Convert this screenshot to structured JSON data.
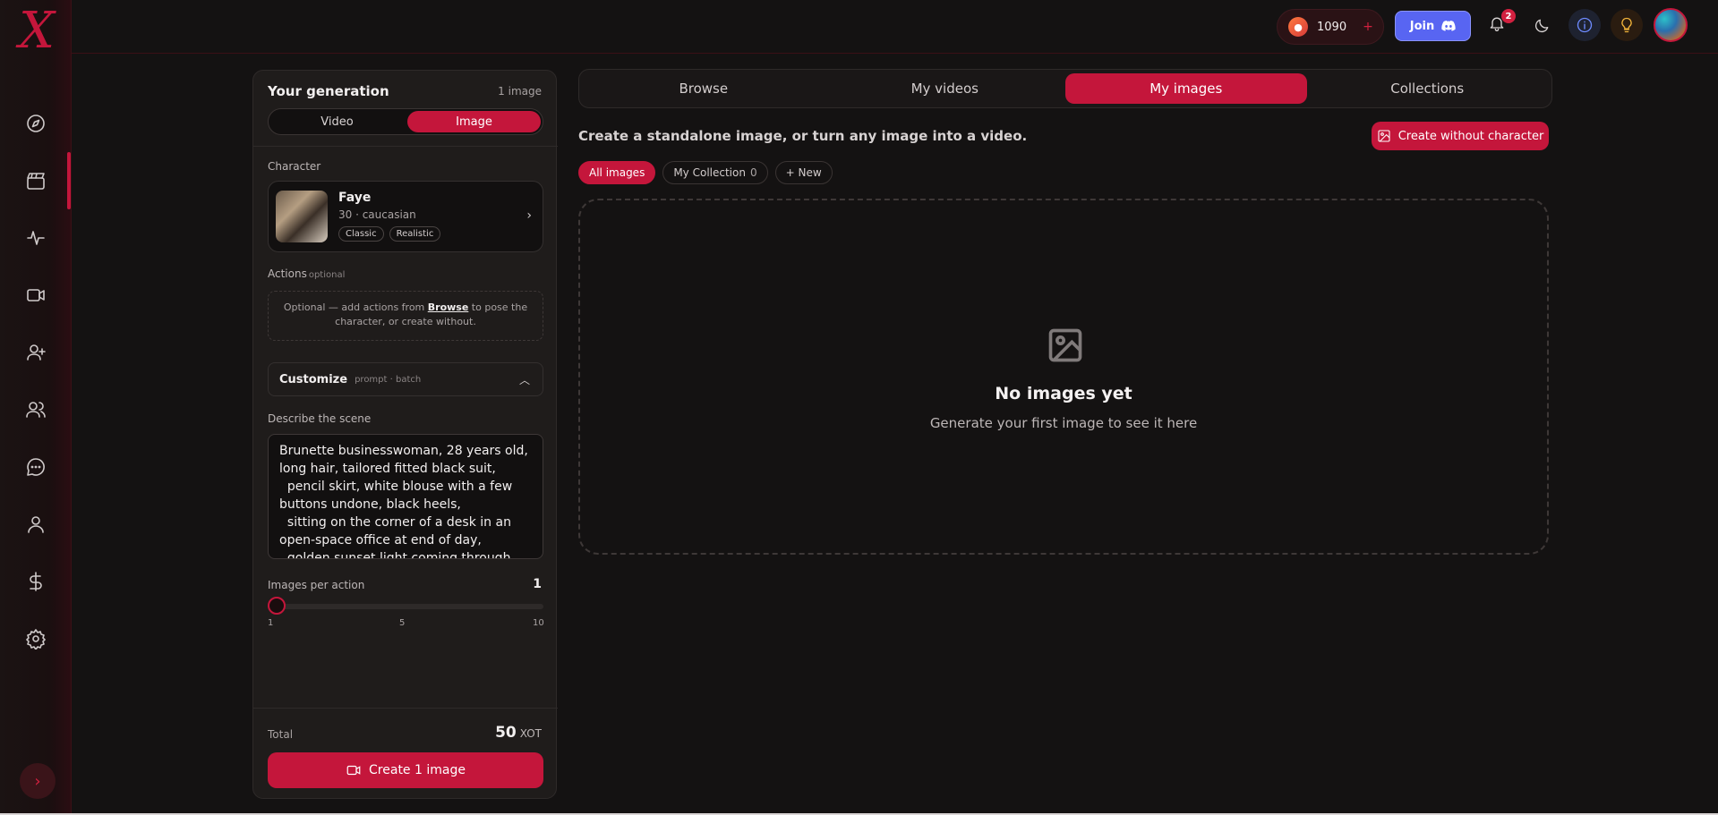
{
  "topbar": {
    "credits": "1090",
    "credits_plus": "+",
    "join_label": "Join",
    "notification_count": "2"
  },
  "sidebar": {
    "logo": "X",
    "items": [
      "explore",
      "clapperboard",
      "activity",
      "video",
      "user-plus",
      "users",
      "chat",
      "user",
      "dollar",
      "settings"
    ],
    "expand_glyph": "›"
  },
  "generation": {
    "title": "Your generation",
    "count": "1 image",
    "modes": [
      "Video",
      "Image"
    ],
    "active_mode": "Image",
    "character_label": "Character",
    "character": {
      "name": "Faye",
      "meta": "30 · caucasian",
      "tags": [
        "Classic",
        "Realistic"
      ]
    },
    "actions_label": "Actions",
    "actions_optional": "optional",
    "actions_hint_before": "Optional — add actions from ",
    "actions_hint_link": "Browse",
    "actions_hint_after": " to pose the character, or create without.",
    "customize_title": "Customize",
    "customize_sub": "prompt · batch",
    "scene_label": "Describe the scene",
    "scene_text": "Brunette businesswoman, 28 years old, long hair, tailored fitted black suit,\n  pencil skirt, white blouse with a few buttons undone, black heels,\n  sitting on the corner of a desk in an open-space office at end of day,\n  golden sunset light coming through",
    "images_per_action_label": "Images per action",
    "images_per_action_value": "1",
    "slider_min": "1",
    "slider_mid": "5",
    "slider_max": "10",
    "slider_fraction": 0.0,
    "total_label": "Total",
    "total_value": "50",
    "total_unit": "XOT",
    "create_label": "Create 1 image"
  },
  "main": {
    "tabs": [
      "Browse",
      "My videos",
      "My images",
      "Collections"
    ],
    "active_tab": "My images",
    "subtitle": "Create a standalone image, or turn any image into a video.",
    "create_without_label": "Create without character",
    "filters": {
      "all_images": "All images",
      "my_collection": "My Collection",
      "my_collection_count": "0",
      "new": "+ New"
    },
    "empty_title": "No images yet",
    "empty_sub": "Generate your first image to see it here"
  },
  "colors": {
    "accent": "#c4163b",
    "background": "#141212",
    "panel": "#1f1c1b",
    "discord": "#5865f2"
  }
}
